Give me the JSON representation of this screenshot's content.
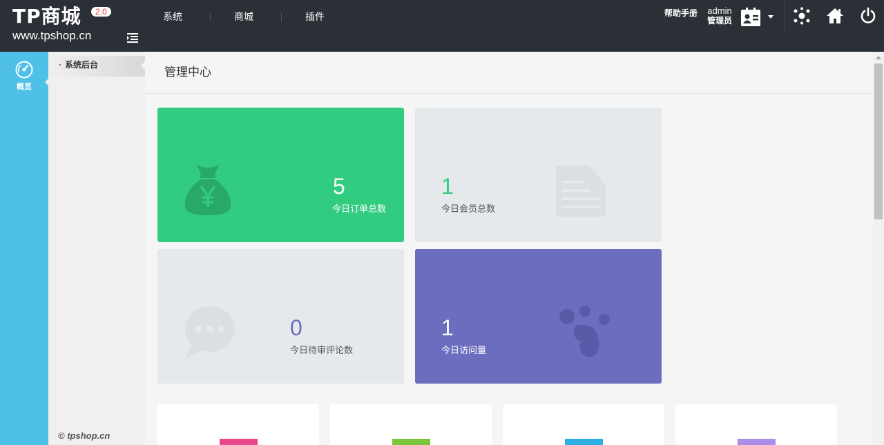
{
  "header": {
    "logo_text": "TP商城",
    "logo_domain": "www.tpshop.cn",
    "version": "2.0",
    "nav": [
      {
        "label": "系统"
      },
      {
        "label": "商城"
      },
      {
        "label": "插件"
      }
    ],
    "help_label": "帮助手册",
    "user": {
      "name": "admin",
      "role": "管理员"
    }
  },
  "sidebar": {
    "overview_label": "概览",
    "submenu": [
      {
        "label": "系统后台"
      }
    ],
    "copyright": "© tpshop.cn"
  },
  "main": {
    "title": "管理中心",
    "stats": [
      {
        "value": "5",
        "label": "今日订单总数",
        "color": "#31cc7f",
        "icon": "money-bag-icon"
      },
      {
        "value": "1",
        "label": "今日会员总数",
        "color": "#e5e9ec",
        "icon": "document-icon"
      },
      {
        "value": "0",
        "label": "今日待审评论数",
        "color": "#e5e9ec",
        "icon": "chat-bubble-icon"
      },
      {
        "value": "1",
        "label": "今日访问量",
        "color": "#6d6dc0",
        "icon": "footprint-icon"
      }
    ],
    "bottom_cards": [
      {
        "accent": "#e8488a"
      },
      {
        "accent": "#7bc63a"
      },
      {
        "accent": "#2eaee0"
      },
      {
        "accent": "#a98de8"
      }
    ]
  },
  "colors": {
    "topbar": "#2b2f36",
    "sidebar": "#4fc0e8",
    "green": "#31cc7f",
    "purple": "#6d6dc0"
  }
}
